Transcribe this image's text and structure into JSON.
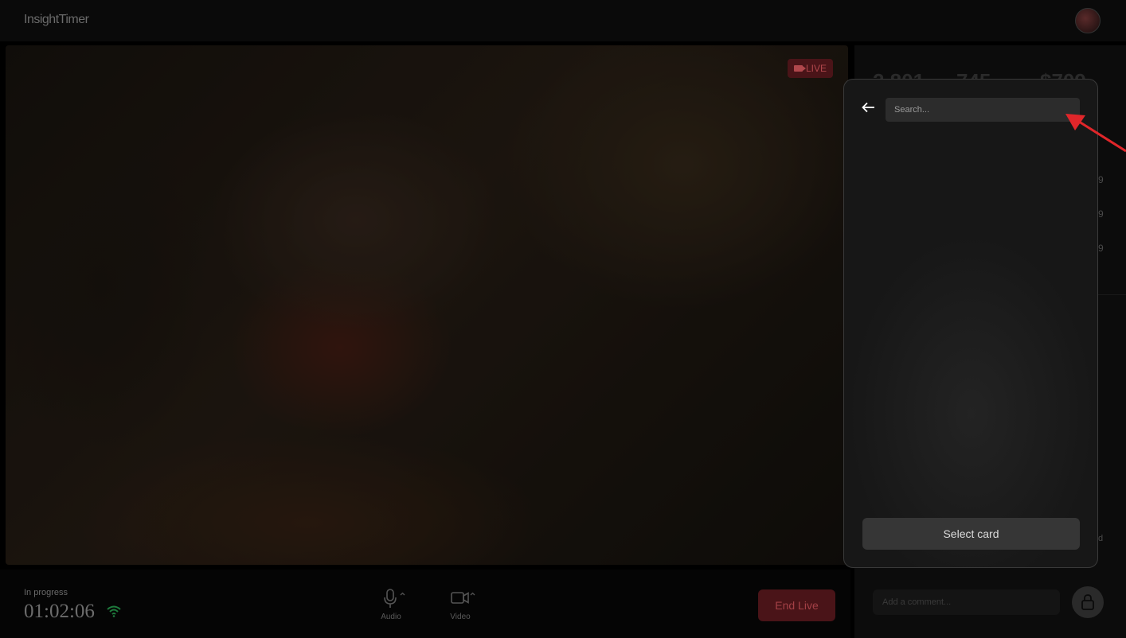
{
  "header": {
    "brand": "InsightTimer"
  },
  "video": {
    "live_label": "LIVE"
  },
  "footer": {
    "status_label": "In progress",
    "timer": "01:02:06",
    "audio_label": "Audio",
    "video_label": "Video",
    "end_live_label": "End Live"
  },
  "sidebar": {
    "stats": [
      "2,801",
      "745",
      "$709"
    ],
    "row_fragments": [
      "9",
      "9",
      "9"
    ],
    "small_fragment": "d",
    "comment_placeholder": "Add a comment..."
  },
  "modal": {
    "search_placeholder": "Search...",
    "select_button_label": "Select card"
  },
  "colors": {
    "accent_live": "#b0474c",
    "end_live_bg": "#4a1418",
    "wifi_green": "#1e7a3c",
    "annotation_red": "#e0262a"
  },
  "icons": [
    "back-arrow-icon",
    "microphone-icon",
    "video-camera-icon",
    "wifi-icon",
    "lock-icon",
    "camera-icon"
  ]
}
